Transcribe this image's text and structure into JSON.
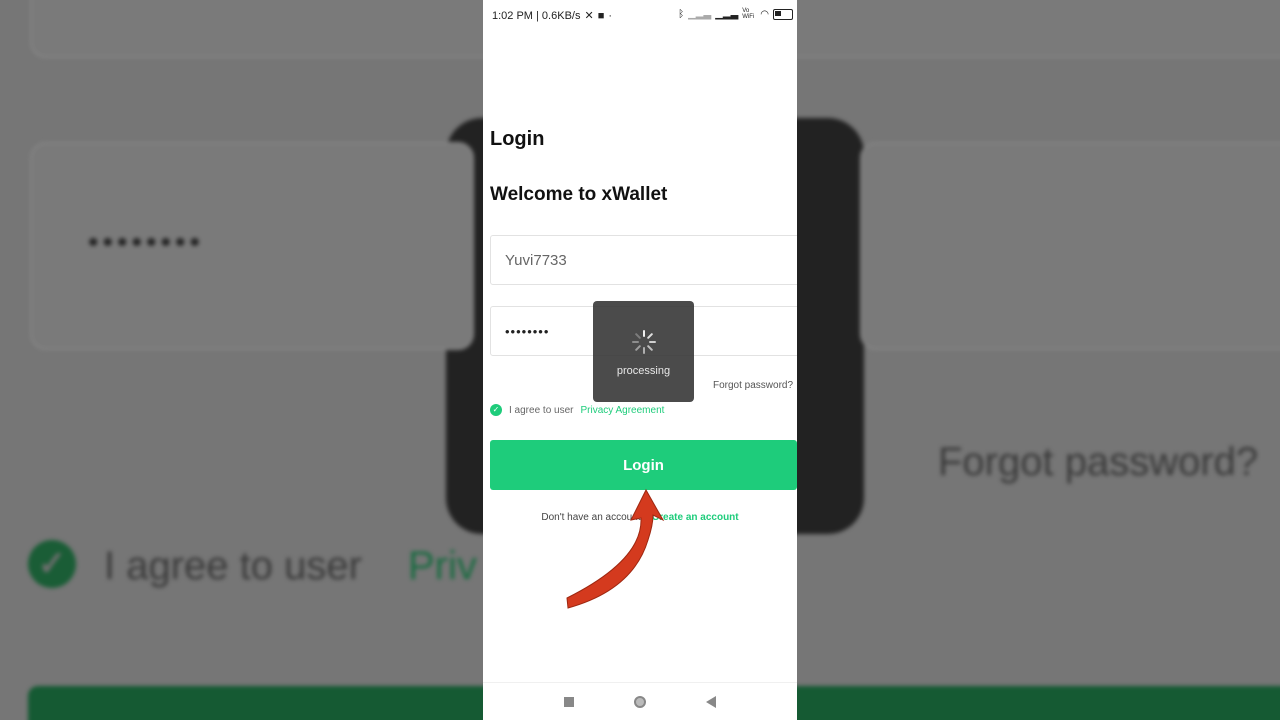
{
  "status_bar": {
    "time_speed": "1:02 PM | 0.6KB/s",
    "volte_label": "Vo WiFi"
  },
  "screen": {
    "title": "Login",
    "welcome": "Welcome to xWallet"
  },
  "form": {
    "username_value": "Yuvi7733",
    "password_value": "••••••••",
    "forgot_password": "Forgot password?",
    "agree_text": "I agree to user",
    "privacy_link": "Privacy Agreement",
    "agree_checked": true,
    "login_button": "Login",
    "no_account_text": "Don't have an account?",
    "create_account_link": "Create an account"
  },
  "overlay": {
    "processing_text": "processing"
  },
  "background": {
    "dots": "••••••••",
    "forgot_password": "Forgot password?",
    "agree_text": "I agree to user",
    "privacy_fragment": "Priv"
  },
  "colors": {
    "accent": "#1ecc7b",
    "arrow": "#d43a1e"
  }
}
